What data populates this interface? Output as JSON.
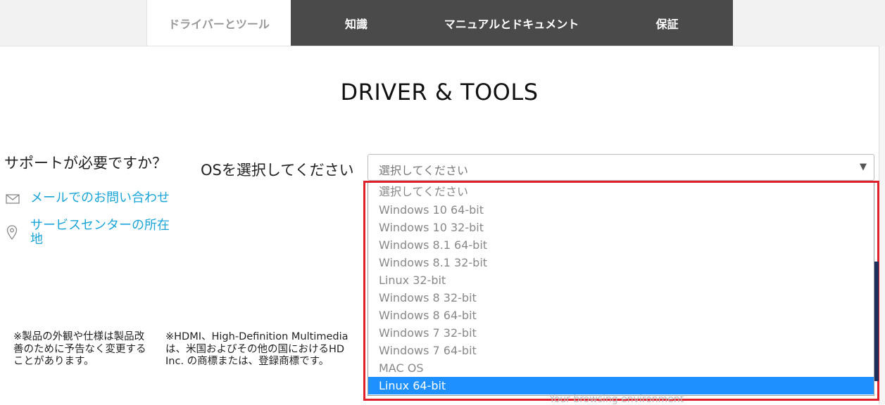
{
  "tabs": [
    {
      "label": "ドライバーとツール",
      "active": true
    },
    {
      "label": "知識",
      "active": false
    },
    {
      "label": "マニュアルとドキュメント",
      "active": false
    },
    {
      "label": "保証",
      "active": false
    }
  ],
  "page_title": "DRIVER & TOOLS",
  "support": {
    "title": "サポートが必要ですか？",
    "mail_link": "メールでのお問い合わせ",
    "service_link_line1": "サービスセンターの所在",
    "service_link_line2": "地"
  },
  "os": {
    "label": "OSを選択してください",
    "selected_value": "選択してください",
    "options": [
      "選択してください",
      "Windows 10 64-bit",
      "Windows 10 32-bit",
      "Windows 8.1 64-bit",
      "Windows 8.1 32-bit",
      "Linux 32-bit",
      "Windows 8 32-bit",
      "Windows 8 64-bit",
      "Windows 7 32-bit",
      "Windows 7 64-bit",
      "MAC OS",
      "Linux 64-bit"
    ],
    "highlighted_option": "Linux 64-bit"
  },
  "footnotes": {
    "note1_line1": "※製品の外観や仕様は製品改",
    "note1_line2": "善のために予告なく変更する",
    "note1_line3": "ことがあります。",
    "note2_line1": "※HDMI、High-Definition Multimedia",
    "note2_line2": "は、米国およびその他の国におけるHD",
    "note2_line3": "Inc. の商標または、登録商標です。"
  },
  "background_text": "Your browsing environment",
  "colors": {
    "tab_dark": "#4a4a4a",
    "link": "#1aa5d8",
    "selected_option": "#1e90ff",
    "highlight_box": "#e0202a"
  }
}
